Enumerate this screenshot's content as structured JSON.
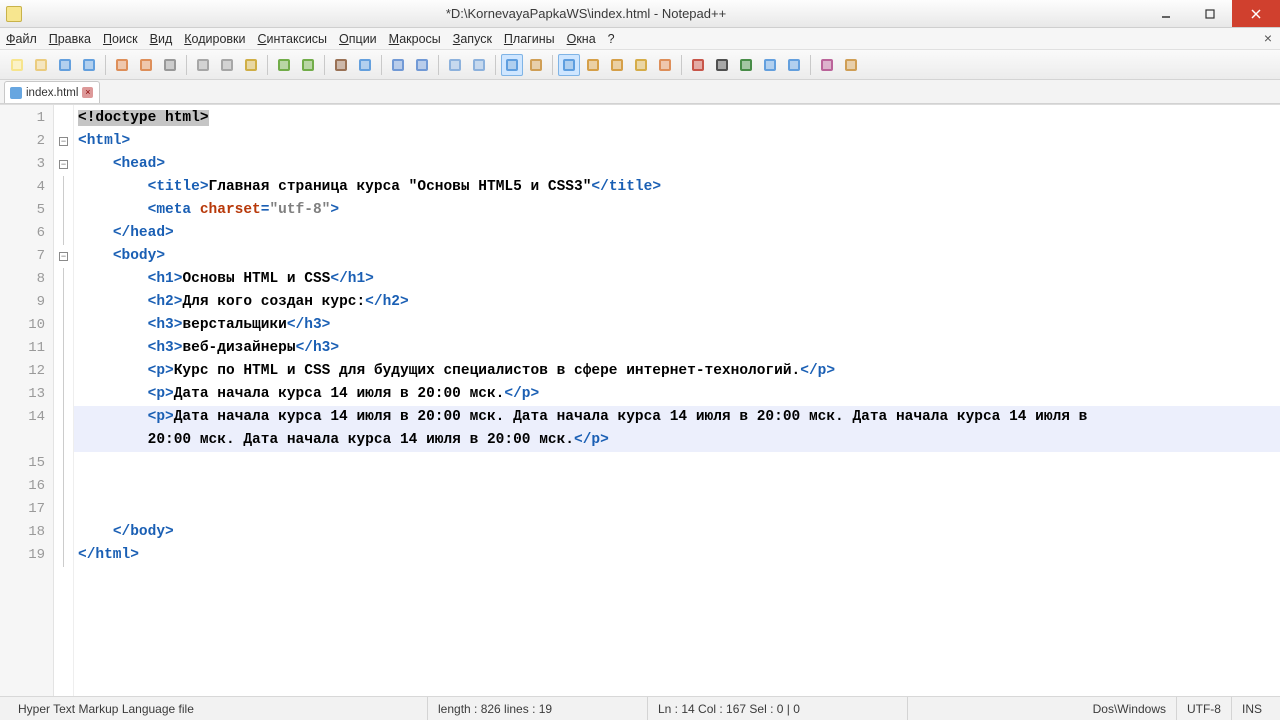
{
  "window": {
    "title": "*D:\\KornevayaPapkaWS\\index.html - Notepad++"
  },
  "menu": {
    "items": [
      "Файл",
      "Правка",
      "Поиск",
      "Вид",
      "Кодировки",
      "Синтаксисы",
      "Опции",
      "Макросы",
      "Запуск",
      "Плагины",
      "Окна",
      "?"
    ]
  },
  "tab": {
    "name": "index.html"
  },
  "code": {
    "lines": [
      {
        "n": 1,
        "indent": 0,
        "fold": "",
        "segs": [
          [
            "sel",
            "<!doctype html>"
          ]
        ]
      },
      {
        "n": 2,
        "indent": 0,
        "fold": "minus",
        "segs": [
          [
            "tg",
            "<html>"
          ]
        ]
      },
      {
        "n": 3,
        "indent": 1,
        "fold": "minus",
        "segs": [
          [
            "tg",
            "<head>"
          ]
        ]
      },
      {
        "n": 4,
        "indent": 2,
        "fold": "",
        "segs": [
          [
            "tg",
            "<title>"
          ],
          [
            "txt",
            "Главная страница курса \"Основы HTML5 и CSS3\""
          ],
          [
            "tg",
            "</title>"
          ]
        ]
      },
      {
        "n": 5,
        "indent": 2,
        "fold": "",
        "segs": [
          [
            "tg",
            "<meta "
          ],
          [
            "attr",
            "charset"
          ],
          [
            "tg",
            "="
          ],
          [
            "str",
            "\"utf-8\""
          ],
          [
            "tg",
            ">"
          ]
        ]
      },
      {
        "n": 6,
        "indent": 1,
        "fold": "",
        "segs": [
          [
            "tg",
            "</head>"
          ]
        ]
      },
      {
        "n": 7,
        "indent": 1,
        "fold": "minus",
        "segs": [
          [
            "tg",
            "<body>"
          ]
        ]
      },
      {
        "n": 8,
        "indent": 2,
        "fold": "",
        "segs": [
          [
            "tg",
            "<h1>"
          ],
          [
            "txt",
            "Основы HTML и CSS"
          ],
          [
            "tg",
            "</h1>"
          ]
        ]
      },
      {
        "n": 9,
        "indent": 2,
        "fold": "",
        "segs": [
          [
            "tg",
            "<h2>"
          ],
          [
            "txt",
            "Для кого создан курс:"
          ],
          [
            "tg",
            "</h2>"
          ]
        ]
      },
      {
        "n": 10,
        "indent": 2,
        "fold": "",
        "segs": [
          [
            "tg",
            "<h3>"
          ],
          [
            "txt",
            "верстальщики"
          ],
          [
            "tg",
            "</h3>"
          ]
        ]
      },
      {
        "n": 11,
        "indent": 2,
        "fold": "",
        "segs": [
          [
            "tg",
            "<h3>"
          ],
          [
            "txt",
            "веб-дизайнеры"
          ],
          [
            "tg",
            "</h3>"
          ]
        ]
      },
      {
        "n": 12,
        "indent": 2,
        "fold": "",
        "segs": [
          [
            "tg",
            "<p>"
          ],
          [
            "txt",
            "Курс по HTML и CSS для будущих специалистов в сфере интернет-технологий."
          ],
          [
            "tg",
            "</p>"
          ]
        ]
      },
      {
        "n": 13,
        "indent": 2,
        "fold": "",
        "segs": [
          [
            "tg",
            "<p>"
          ],
          [
            "txt",
            "Дата начала курса 14 июля в 20:00 мск."
          ],
          [
            "tg",
            "</p>"
          ]
        ]
      },
      {
        "n": 14,
        "indent": 2,
        "fold": "",
        "hl": true,
        "segs": [
          [
            "tg",
            "<p>"
          ],
          [
            "txt",
            "Дата начала курса 14 июля в 20:00 мск. Дата начала курса 14 июля в 20:00 мск. Дата начала курса 14 июля в"
          ]
        ]
      },
      {
        "n": 0,
        "cont": true,
        "indent": 2,
        "fold": "",
        "hl": true,
        "segs": [
          [
            "txt",
            "20:00 мск. Дата начала курса 14 июля в 20:00 мск."
          ],
          [
            "tg",
            "</p>"
          ]
        ]
      },
      {
        "n": 15,
        "indent": 0,
        "fold": "",
        "segs": []
      },
      {
        "n": 16,
        "indent": 0,
        "fold": "",
        "segs": []
      },
      {
        "n": 17,
        "indent": 0,
        "fold": "",
        "segs": []
      },
      {
        "n": 18,
        "indent": 1,
        "fold": "",
        "segs": [
          [
            "tg",
            "</body>"
          ]
        ]
      },
      {
        "n": 19,
        "indent": 0,
        "fold": "",
        "segs": [
          [
            "tg",
            "</html>"
          ]
        ]
      }
    ]
  },
  "status": {
    "filetype": "Hyper Text Markup Language file",
    "length": "length : 826    lines : 19",
    "pos": "Ln : 14    Col : 167    Sel : 0 | 0",
    "eol": "Dos\\Windows",
    "enc": "UTF-8",
    "ins": "INS"
  },
  "toolbar_icons": [
    {
      "name": "new-file-icon",
      "c": "#f7e27a"
    },
    {
      "name": "open-icon",
      "c": "#e9c46a"
    },
    {
      "name": "save-icon",
      "c": "#4a90d9"
    },
    {
      "name": "save-all-icon",
      "c": "#4a90d9"
    },
    {
      "sep": true
    },
    {
      "name": "close-file-icon",
      "c": "#d97c3e"
    },
    {
      "name": "close-all-icon",
      "c": "#d97c3e"
    },
    {
      "name": "print-icon",
      "c": "#888"
    },
    {
      "sep": true
    },
    {
      "name": "cut-icon",
      "c": "#999"
    },
    {
      "name": "copy-icon",
      "c": "#999"
    },
    {
      "name": "paste-icon",
      "c": "#c9a227"
    },
    {
      "sep": true
    },
    {
      "name": "undo-icon",
      "c": "#5aa02c"
    },
    {
      "name": "redo-icon",
      "c": "#5aa02c"
    },
    {
      "sep": true
    },
    {
      "name": "find-icon",
      "c": "#8a5a3a"
    },
    {
      "name": "replace-icon",
      "c": "#4a90d9"
    },
    {
      "sep": true
    },
    {
      "name": "zoom-in-icon",
      "c": "#5a8ad0"
    },
    {
      "name": "zoom-out-icon",
      "c": "#5a8ad0"
    },
    {
      "sep": true
    },
    {
      "name": "sync-v-icon",
      "c": "#7aa6d8"
    },
    {
      "name": "sync-h-icon",
      "c": "#7aa6d8"
    },
    {
      "sep": true
    },
    {
      "name": "wordwrap-icon",
      "c": "#4a90d9",
      "active": true
    },
    {
      "name": "show-all-icon",
      "c": "#c98f3a"
    },
    {
      "sep": true
    },
    {
      "name": "indent-guide-icon",
      "c": "#4a90d9",
      "active": true
    },
    {
      "name": "user-lang-icon",
      "c": "#d0902a"
    },
    {
      "name": "doc-map-icon",
      "c": "#d0902a"
    },
    {
      "name": "func-list-icon",
      "c": "#d0a02a"
    },
    {
      "name": "folder-icon",
      "c": "#d97c3e"
    },
    {
      "sep": true
    },
    {
      "name": "record-icon",
      "c": "#c0392b"
    },
    {
      "name": "stop-icon",
      "c": "#333"
    },
    {
      "name": "play-icon",
      "c": "#2a7a2a"
    },
    {
      "name": "play-multi-icon",
      "c": "#4a90d9"
    },
    {
      "name": "save-macro-icon",
      "c": "#4a90d9"
    },
    {
      "sep": true
    },
    {
      "name": "spellcheck-icon",
      "c": "#b04a8a"
    },
    {
      "name": "about-icon",
      "c": "#c98f3a"
    }
  ]
}
